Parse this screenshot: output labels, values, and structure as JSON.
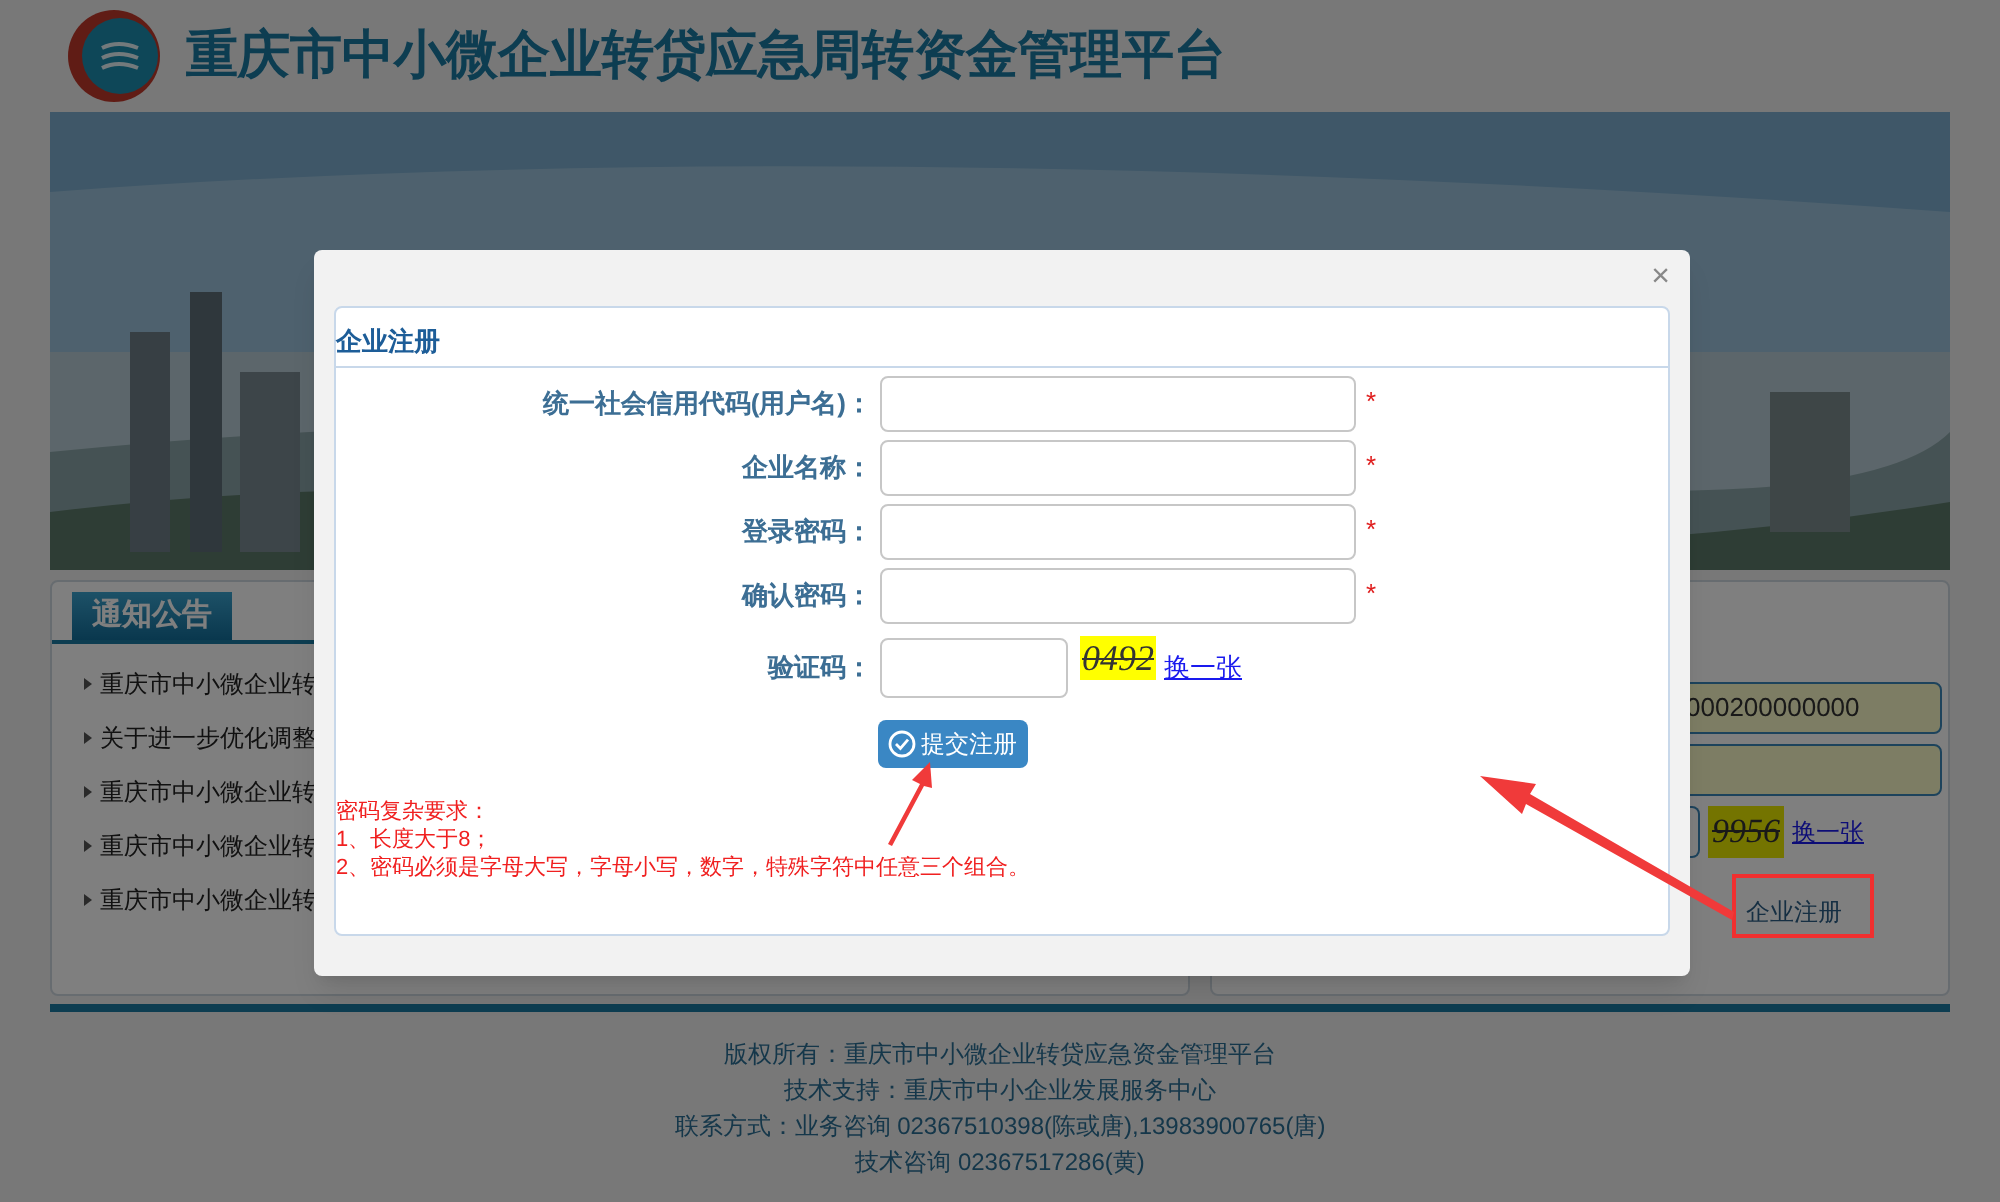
{
  "header": {
    "title": "重庆市中小微企业转贷应急周转资金管理平台"
  },
  "banner": {
    "kind": "picture"
  },
  "notices": {
    "tab": "通知公告",
    "items": [
      "重庆市中小微企业转",
      "关于进一步优化调整",
      "重庆市中小微企业转",
      "重庆市中小微企业转",
      "重庆市中小微企业转"
    ]
  },
  "login": {
    "account_value": "000200000000",
    "captcha_code": "9956",
    "refresh": "换一张",
    "register": "企业注册"
  },
  "footer": [
    "版权所有：重庆市中小微企业转贷应急资金管理平台",
    "技术支持：重庆市中小企业发展服务中心",
    "联系方式：业务咨询 02367510398(陈或唐),13983900765(唐)",
    "技术咨询 02367517286(黄)"
  ],
  "modal": {
    "close": "×",
    "title": "企业注册",
    "fields": [
      {
        "label": "统一社会信用代码(用户名)：",
        "required": true
      },
      {
        "label": "企业名称：",
        "required": true
      },
      {
        "label": "登录密码：",
        "required": true
      },
      {
        "label": "确认密码：",
        "required": true
      }
    ],
    "required_mark": "*",
    "captcha": {
      "label": "验证码：",
      "code": "0492",
      "refresh": "换一张"
    },
    "submit": "提交注册",
    "rules": [
      "密码复杂要求：",
      "1、长度大于8；",
      "2、密码必须是字母大写，字母小写，数字，特殊字符中任意三个组合。"
    ]
  }
}
